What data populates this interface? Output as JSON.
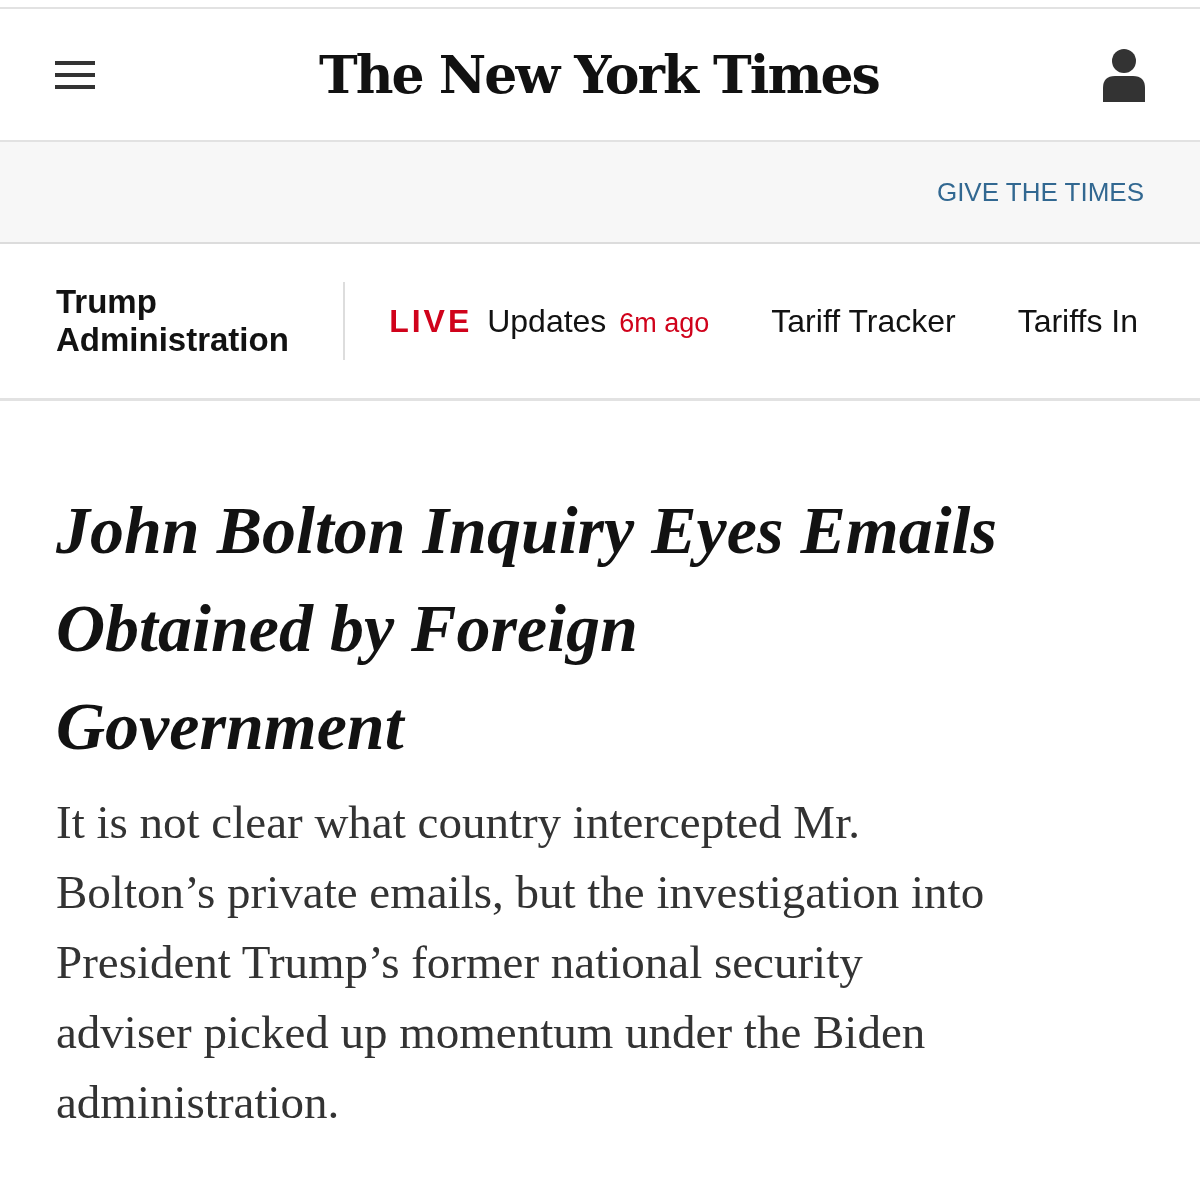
{
  "header": {
    "logo": "The New York Times"
  },
  "banner": {
    "link": "GIVE THE TIMES"
  },
  "section_nav": {
    "section": "Trump Administration",
    "items": [
      {
        "kind": "live",
        "badge": "LIVE",
        "label": "Updates",
        "time": "6m ago"
      },
      {
        "kind": "link",
        "label": "Tariff Tracker"
      },
      {
        "kind": "link",
        "label": "Tariffs In"
      }
    ]
  },
  "article": {
    "headline_lines": [
      "John Bolton Inquiry Eyes Emails",
      "Obtained by Foreign",
      "Government"
    ],
    "summary_lines": [
      "It is not clear what country intercepted Mr.",
      "Bolton’s private emails, but the investigation into",
      "President Trump’s former national security",
      "adviser picked up momentum under the Biden",
      "administration."
    ]
  }
}
